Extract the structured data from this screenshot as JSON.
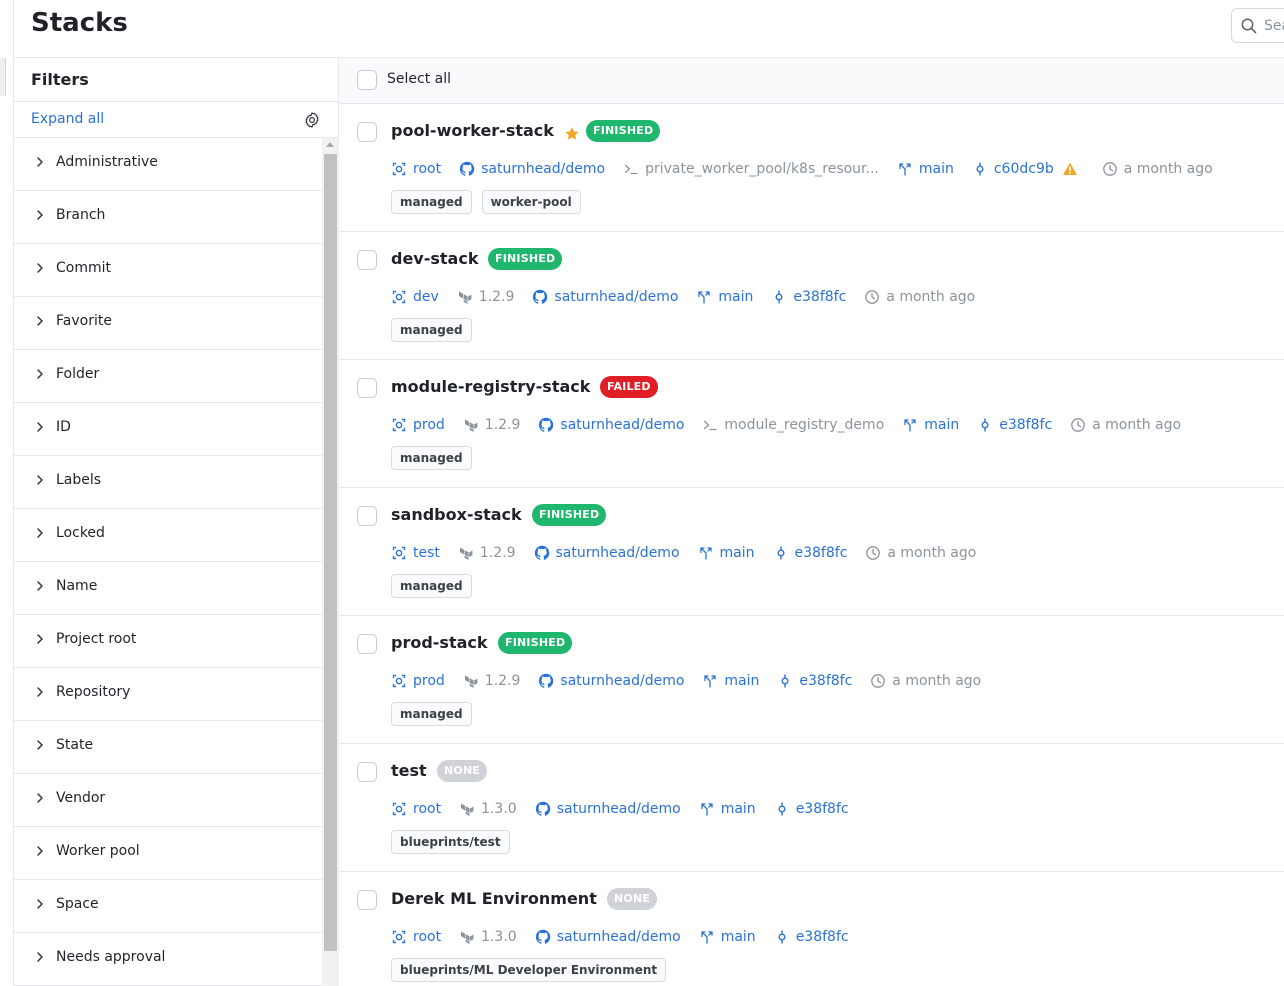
{
  "page": {
    "title": "Stacks"
  },
  "search": {
    "placeholder": "Search"
  },
  "filters": {
    "title": "Filters",
    "expand_all": "Expand all",
    "items": [
      "Administrative",
      "Branch",
      "Commit",
      "Favorite",
      "Folder",
      "ID",
      "Labels",
      "Locked",
      "Name",
      "Project root",
      "Repository",
      "State",
      "Vendor",
      "Worker pool",
      "Space",
      "Needs approval"
    ]
  },
  "list": {
    "select_all": "Select all",
    "stacks": [
      {
        "name": "pool-worker-stack",
        "favorite": true,
        "state": "FINISHED",
        "space": "root",
        "version": "",
        "repo": "saturnhead/demo",
        "project_root": "private_worker_pool/k8s_resour...",
        "branch": "main",
        "commit": "c60dc9b",
        "warning": true,
        "time": "a month ago",
        "labels": [
          "managed",
          "worker-pool"
        ]
      },
      {
        "name": "dev-stack",
        "favorite": false,
        "state": "FINISHED",
        "space": "dev",
        "version": "1.2.9",
        "repo": "saturnhead/demo",
        "project_root": "",
        "branch": "main",
        "commit": "e38f8fc",
        "warning": false,
        "time": "a month ago",
        "labels": [
          "managed"
        ]
      },
      {
        "name": "module-registry-stack",
        "favorite": false,
        "state": "FAILED",
        "space": "prod",
        "version": "1.2.9",
        "repo": "saturnhead/demo",
        "project_root": "module_registry_demo",
        "branch": "main",
        "commit": "e38f8fc",
        "warning": false,
        "time": "a month ago",
        "labels": [
          "managed"
        ]
      },
      {
        "name": "sandbox-stack",
        "favorite": false,
        "state": "FINISHED",
        "space": "test",
        "version": "1.2.9",
        "repo": "saturnhead/demo",
        "project_root": "",
        "branch": "main",
        "commit": "e38f8fc",
        "warning": false,
        "time": "a month ago",
        "labels": [
          "managed"
        ]
      },
      {
        "name": "prod-stack",
        "favorite": false,
        "state": "FINISHED",
        "space": "prod",
        "version": "1.2.9",
        "repo": "saturnhead/demo",
        "project_root": "",
        "branch": "main",
        "commit": "e38f8fc",
        "warning": false,
        "time": "a month ago",
        "labels": [
          "managed"
        ]
      },
      {
        "name": "test",
        "favorite": false,
        "state": "NONE",
        "space": "root",
        "version": "1.3.0",
        "repo": "saturnhead/demo",
        "project_root": "",
        "branch": "main",
        "commit": "e38f8fc",
        "warning": false,
        "time": "",
        "labels": [
          "blueprints/test"
        ]
      },
      {
        "name": "Derek ML Environment",
        "favorite": false,
        "state": "NONE",
        "space": "root",
        "version": "1.3.0",
        "repo": "saturnhead/demo",
        "project_root": "",
        "branch": "main",
        "commit": "e38f8fc",
        "warning": false,
        "time": "",
        "labels": [
          "blueprints/ML Developer Environment"
        ]
      }
    ]
  },
  "colors": {
    "link": "#2b72d8",
    "finished": "#1fb66d",
    "failed": "#e11d26",
    "none": "#cfd3d8",
    "favorite": "#f2a629",
    "warning": "#f2a629"
  },
  "icons": {
    "space": "space-icon",
    "vendor": "terraform-icon",
    "repo": "github-icon",
    "project_root": "terminal-icon",
    "branch": "branch-icon",
    "commit": "commit-icon",
    "time": "clock-icon"
  }
}
